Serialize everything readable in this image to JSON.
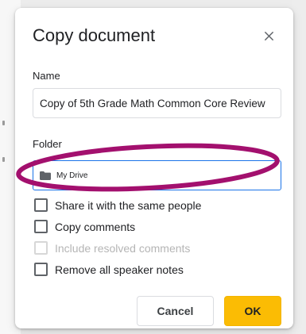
{
  "dialog": {
    "title": "Copy document",
    "close_icon": "close-icon"
  },
  "name_field": {
    "label": "Name",
    "value": "Copy of 5th Grade Math Common Core Review"
  },
  "folder_field": {
    "label": "Folder",
    "icon": "folder-icon",
    "value": "My Drive"
  },
  "options": [
    {
      "label": "Share it with the same people",
      "checked": false,
      "enabled": true
    },
    {
      "label": "Copy comments",
      "checked": false,
      "enabled": true
    },
    {
      "label": "Include resolved comments",
      "checked": false,
      "enabled": false
    },
    {
      "label": "Remove all speaker notes",
      "checked": false,
      "enabled": true
    }
  ],
  "actions": {
    "cancel_label": "Cancel",
    "ok_label": "OK"
  },
  "colors": {
    "ok_button": "#fbbc04",
    "focus_border": "#1a73e8",
    "annotation_ellipse": "#a3106e"
  }
}
